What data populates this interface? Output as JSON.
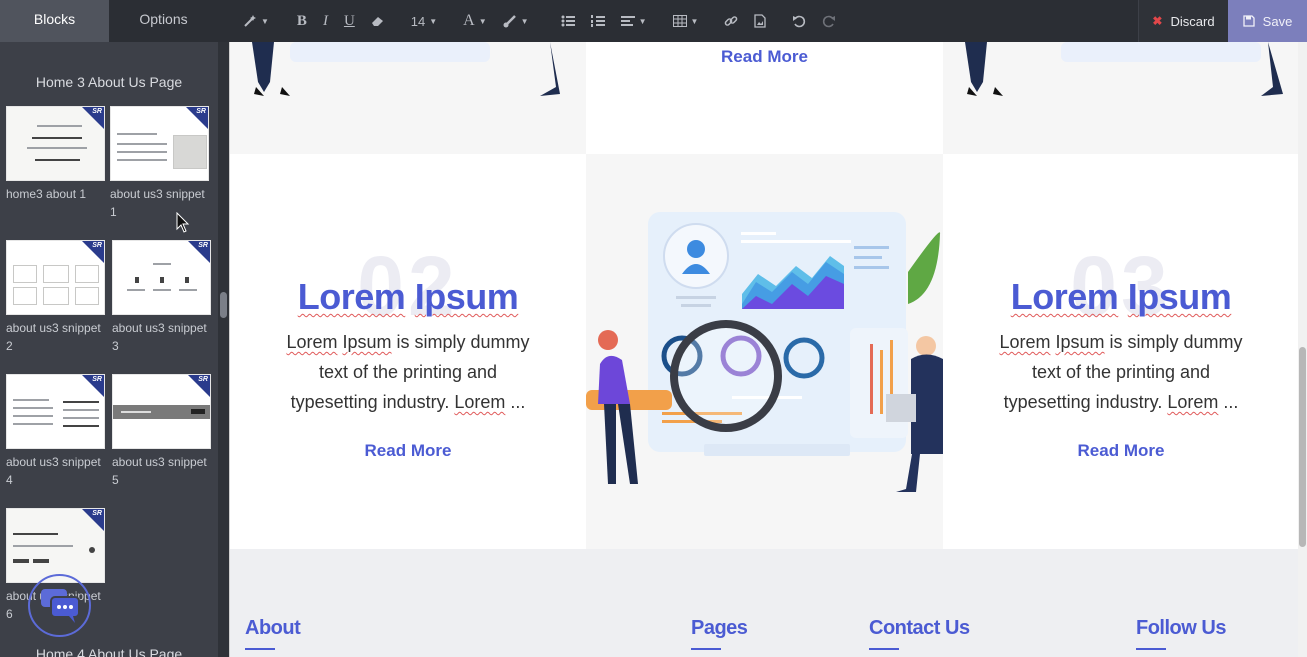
{
  "sidebar": {
    "tabs": [
      {
        "label": "Blocks",
        "active": true
      },
      {
        "label": "Options",
        "active": false
      }
    ],
    "section_title": "Home 3 About Us Page",
    "next_section_title": "Home 4 About Us Page",
    "snippets": [
      {
        "label": "home3 about 1"
      },
      {
        "label": "about us3 snippet 1"
      },
      {
        "label": "about us3 snippet 2"
      },
      {
        "label": "about us3 snippet 3"
      },
      {
        "label": "about us3 snippet 4"
      },
      {
        "label": "about us3 snippet 5"
      },
      {
        "label": "about us3 snippet 6"
      }
    ],
    "badge_text": "SR"
  },
  "toolbar": {
    "font_size": "14",
    "discard_label": "Discard",
    "save_label": "Save"
  },
  "content": {
    "top_read_more": "Read More",
    "cards": [
      {
        "number": "02",
        "title_word1": "Lorem",
        "title_word2": "Ipsum",
        "text_line1_sq1": "Lorem",
        "text_line1_sq2": "Ipsum",
        "text_line1_rest": " is simply dummy",
        "text_line2": "text of the printing and",
        "text_line3_pre": "typesetting industry. ",
        "text_line3_sq": "Lorem",
        "text_line3_post": " ...",
        "read_more": "Read More"
      },
      {
        "number": "03",
        "title_word1": "Lorem",
        "title_word2": "Ipsum",
        "text_line1_sq1": "Lorem",
        "text_line1_sq2": "Ipsum",
        "text_line1_rest": " is simply dummy",
        "text_line2": "text of the printing and",
        "text_line3_pre": "typesetting industry. ",
        "text_line3_sq": "Lorem",
        "text_line3_post": " ...",
        "read_more": "Read More"
      }
    ]
  },
  "footer": {
    "columns": [
      "About",
      "Pages",
      "Contact Us",
      "Follow Us"
    ]
  },
  "colors": {
    "accent": "#4b5bd3",
    "sidebar_bg": "#3d4048",
    "toolbar_bg": "#2b2e34",
    "save_bg": "#7c7fbc",
    "discard_icon": "#e2474a"
  }
}
